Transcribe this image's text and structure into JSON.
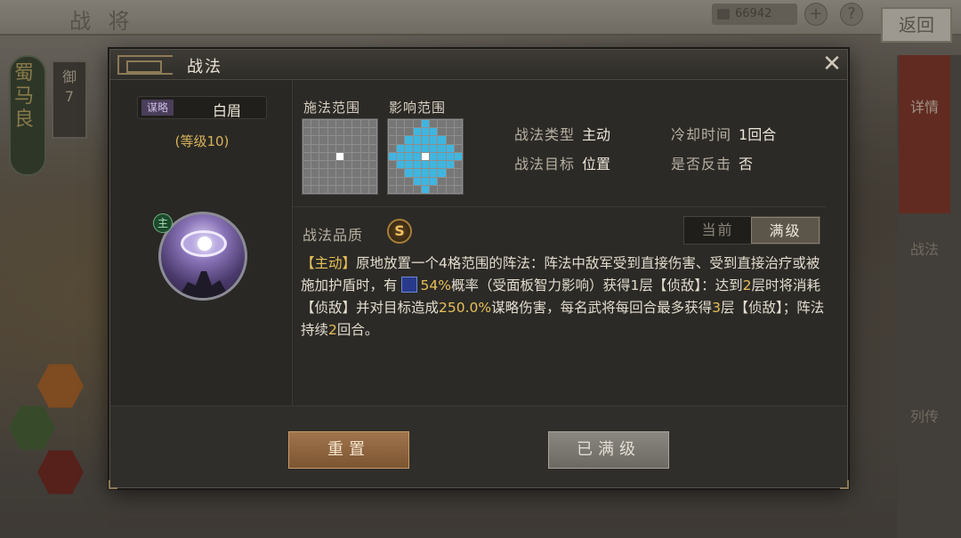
{
  "background": {
    "top_title": "战 将",
    "currency_value": "66942",
    "plus_label": "+",
    "help_label": "?",
    "back_label": "返回",
    "hero_faction": "蜀",
    "hero_name": "马良",
    "hero_rank_label": "御",
    "hero_rank_value": "7",
    "right_tabs": [
      "详情",
      "战法",
      "列传"
    ]
  },
  "modal": {
    "title": "战法",
    "close_label": "✕",
    "skill": {
      "type_badge": "谋略",
      "name": "白眉",
      "level": "(等级10)",
      "main_badge": "主"
    },
    "range": {
      "cast_label": "施法范围",
      "effect_label": "影响范围",
      "cast_grid_size": 9,
      "cast_cells": [
        [
          4,
          4
        ]
      ],
      "effect_cells": [
        [
          0,
          4
        ],
        [
          1,
          3
        ],
        [
          1,
          4
        ],
        [
          1,
          5
        ],
        [
          2,
          2
        ],
        [
          2,
          3
        ],
        [
          2,
          4
        ],
        [
          2,
          5
        ],
        [
          2,
          6
        ],
        [
          3,
          1
        ],
        [
          3,
          2
        ],
        [
          3,
          3
        ],
        [
          3,
          4
        ],
        [
          3,
          5
        ],
        [
          3,
          6
        ],
        [
          3,
          7
        ],
        [
          4,
          0
        ],
        [
          4,
          1
        ],
        [
          4,
          2
        ],
        [
          4,
          3
        ],
        [
          4,
          5
        ],
        [
          4,
          6
        ],
        [
          4,
          7
        ],
        [
          4,
          8
        ],
        [
          5,
          1
        ],
        [
          5,
          2
        ],
        [
          5,
          3
        ],
        [
          5,
          4
        ],
        [
          5,
          5
        ],
        [
          5,
          6
        ],
        [
          5,
          7
        ],
        [
          6,
          2
        ],
        [
          6,
          3
        ],
        [
          6,
          4
        ],
        [
          6,
          5
        ],
        [
          6,
          6
        ],
        [
          7,
          3
        ],
        [
          7,
          4
        ],
        [
          7,
          5
        ],
        [
          8,
          4
        ]
      ],
      "center_cell": [
        4,
        4
      ]
    },
    "info": {
      "type_key": "战法类型",
      "type_val": "主动",
      "cooldown_key": "冷却时间",
      "cooldown_val": "1回合",
      "target_key": "战法目标",
      "target_val": "位置",
      "counter_key": "是否反击",
      "counter_val": "否"
    },
    "quality": {
      "label": "战法品质",
      "grade": "S"
    },
    "toggle": {
      "current": "当前",
      "max": "满级",
      "selected": "max"
    },
    "description": {
      "tag": "【主动】",
      "p1": "原地放置一个4格范围的阵法：阵法中敌军受到直接伤害、受到直接治疗或被施加护盾时，有",
      "prob": "54%",
      "p2": "概率（受面板智力影响）获得1层【侦敌】：达到",
      "stack": "2",
      "p3": "层时将消耗【侦敌】并对目标造成",
      "dmg": "250.0%",
      "p4": "谋略伤害，每名武将每回合最多获得",
      "max_stack": "3",
      "p5": "层【侦敌】；阵法持续",
      "duration": "2",
      "p6": "回合。"
    },
    "buttons": {
      "reset": "重置",
      "maxed": "已满级"
    }
  },
  "colors": {
    "highlight": "#e6c058",
    "effect_cell": "#3fb6e0",
    "reset_button": "#8c6040",
    "maxed_button": "#7a766f"
  }
}
